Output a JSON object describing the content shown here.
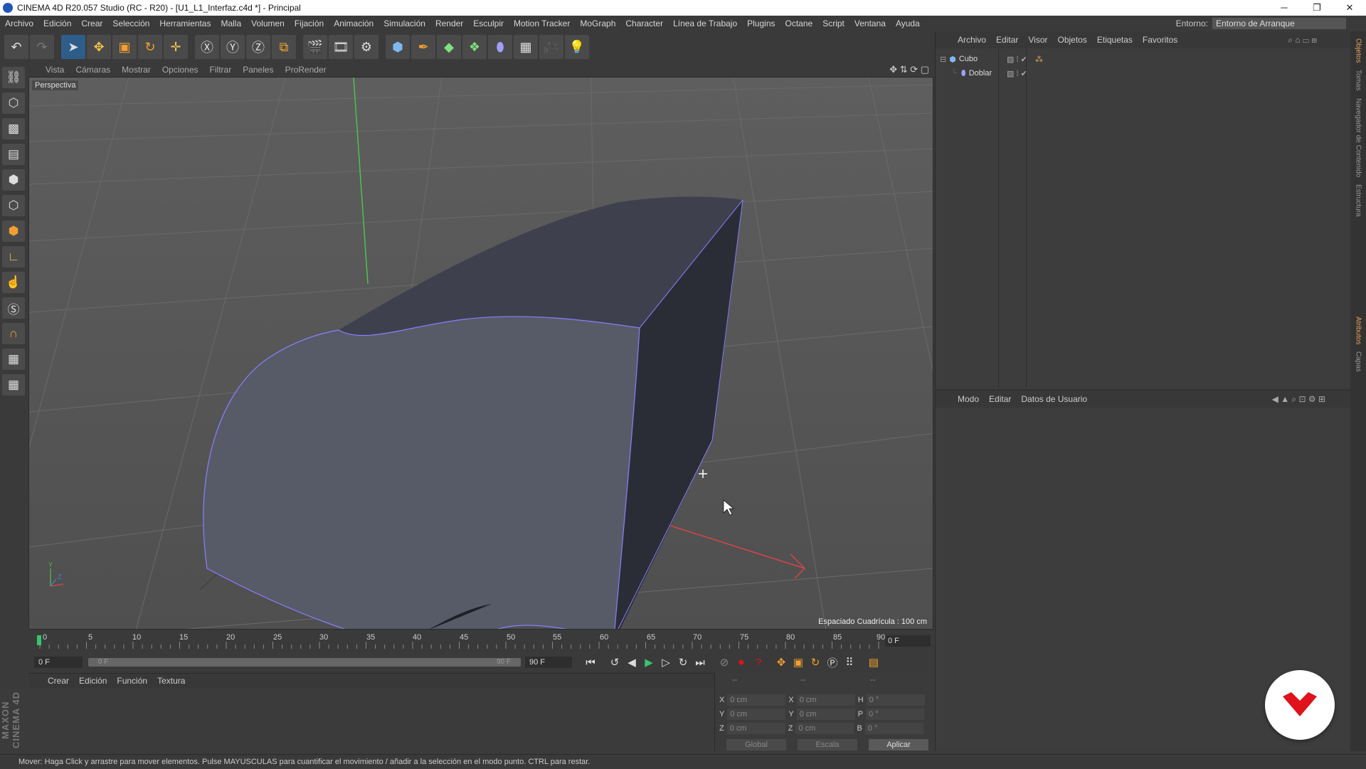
{
  "window": {
    "title": "CINEMA 4D R20.057 Studio (RC - R20) - [U1_L1_Interfaz.c4d *] - Principal",
    "controls": [
      "─",
      "❐",
      "✕"
    ]
  },
  "menubar": {
    "items": [
      "Archivo",
      "Edición",
      "Crear",
      "Selección",
      "Herramientas",
      "Malla",
      "Volumen",
      "Fijación",
      "Animación",
      "Simulación",
      "Render",
      "Esculpir",
      "Motion Tracker",
      "MoGraph",
      "Character",
      "Línea de Trabajo",
      "Plugins",
      "Octane",
      "Script",
      "Ventana",
      "Ayuda"
    ],
    "env_label": "Entorno:",
    "env_value": "Entorno de Arranque"
  },
  "viewport": {
    "menu": [
      "Vista",
      "Cámaras",
      "Mostrar",
      "Opciones",
      "Filtrar",
      "Paneles",
      "ProRender"
    ],
    "label": "Perspectiva",
    "grid_spacing": "Espaciado Cuadrícula : 100 cm"
  },
  "timeline": {
    "ticks": [
      "0",
      "5",
      "10",
      "15",
      "20",
      "25",
      "30",
      "35",
      "40",
      "45",
      "50",
      "55",
      "60",
      "65",
      "70",
      "75",
      "80",
      "85",
      "90"
    ],
    "current_frame": "0 F",
    "start": "0 F",
    "slider_start": "0 F",
    "slider_end": "90 F",
    "end": "90 F"
  },
  "materials": {
    "menu": [
      "Crear",
      "Edición",
      "Función",
      "Textura"
    ]
  },
  "coordinates": {
    "headers": [
      "--",
      "--",
      "--"
    ],
    "rows": [
      {
        "a": "X",
        "v1": "0 cm",
        "b": "X",
        "v2": "0 cm",
        "c": "H",
        "v3": "0 °"
      },
      {
        "a": "Y",
        "v1": "0 cm",
        "b": "Y",
        "v2": "0 cm",
        "c": "P",
        "v3": "0 °"
      },
      {
        "a": "Z",
        "v1": "0 cm",
        "b": "Z",
        "v2": "0 cm",
        "c": "B",
        "v3": "0 °"
      }
    ],
    "mode1": "Global",
    "mode2": "Escala",
    "apply": "Aplicar"
  },
  "objects": {
    "menu": [
      "Archivo",
      "Editar",
      "Visor",
      "Objetos",
      "Etiquetas",
      "Favoritos"
    ],
    "items": [
      {
        "name": "Cubo"
      },
      {
        "name": "Doblar"
      }
    ]
  },
  "attributes": {
    "menu": [
      "Modo",
      "Editar",
      "Datos de Usuario"
    ]
  },
  "sidetabs": [
    "Objetos",
    "Tomas",
    "Navegador de Contenido",
    "Estructura",
    "Atributos",
    "Capas"
  ],
  "branding": "MAXON CINEMA 4D",
  "statusbar": {
    "text": "Mover: Haga Click y arrastre para mover elementos. Pulse MAYUSCULAS para cuantificar el movimiento / añadir a la selección en el modo punto. CTRL para restar."
  },
  "colors": {
    "accent": "#e3a15a",
    "selection": "#8c7dff",
    "x_axis": "#d64545",
    "y_axis": "#4cc24c",
    "badge_red": "#e0121b"
  }
}
